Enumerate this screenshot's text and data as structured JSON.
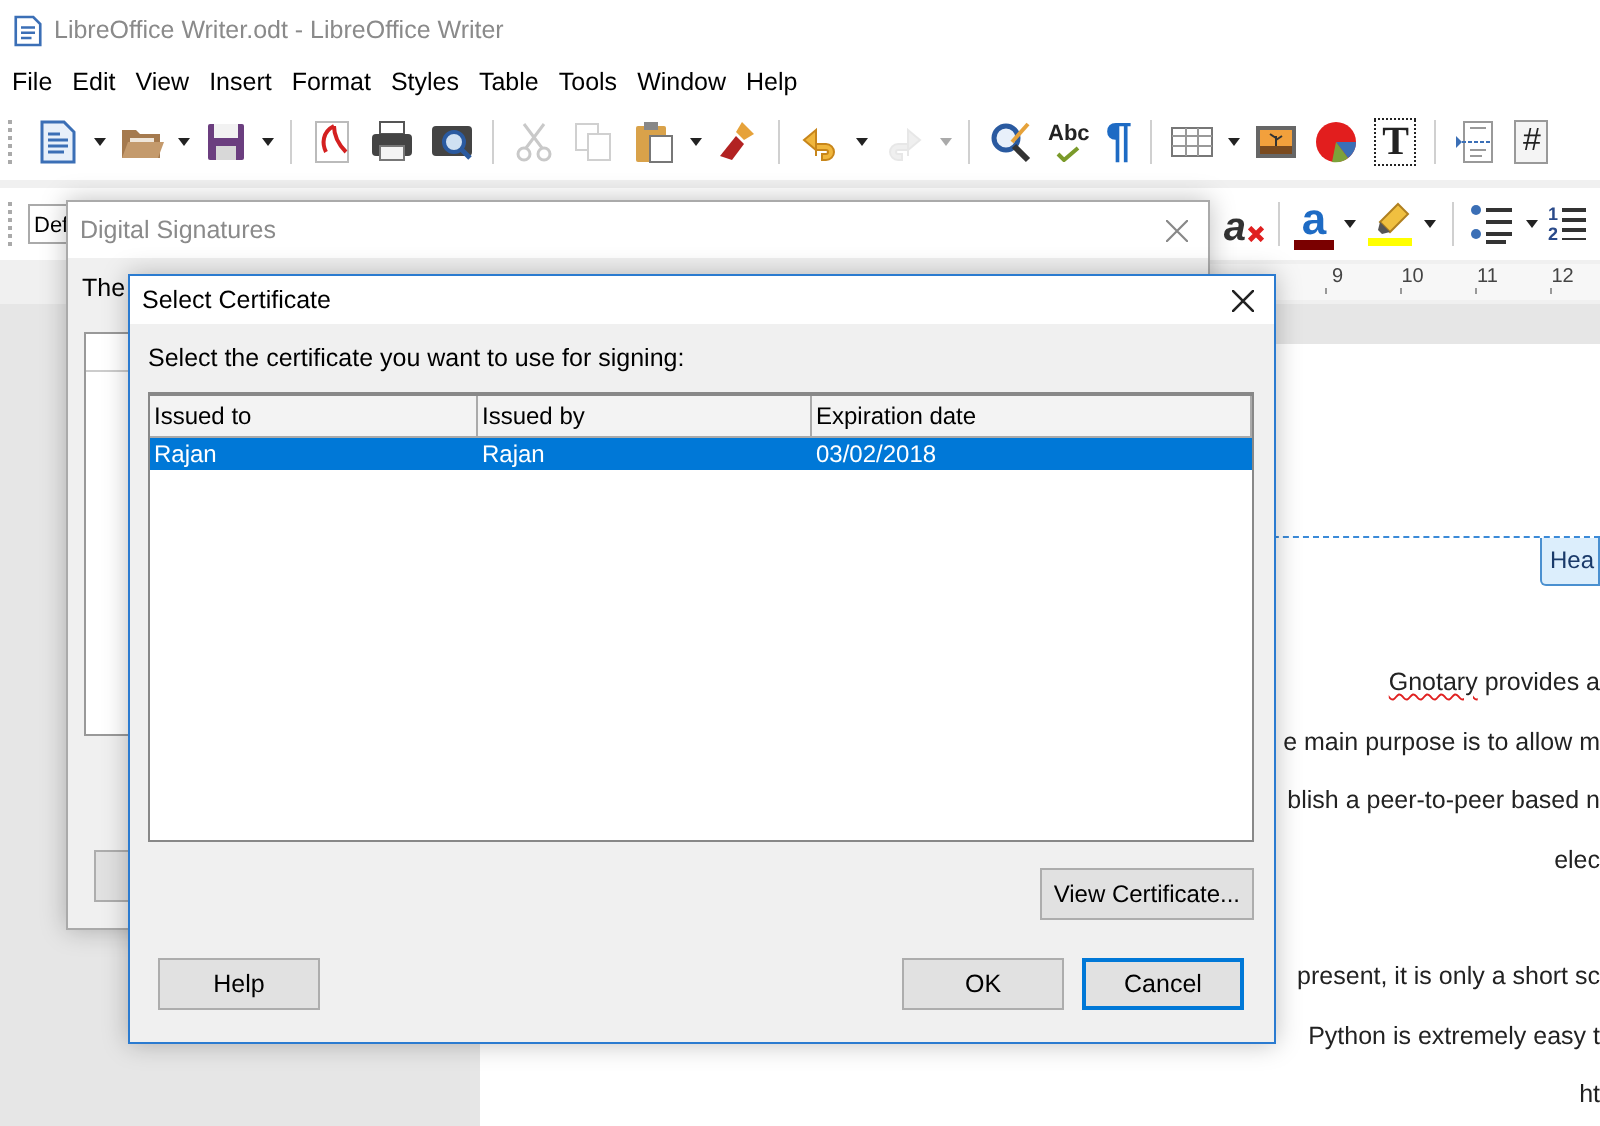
{
  "window": {
    "title": "LibreOffice Writer.odt - LibreOffice Writer",
    "active": false
  },
  "menu": [
    "File",
    "Edit",
    "View",
    "Insert",
    "Format",
    "Styles",
    "Table",
    "Tools",
    "Window",
    "Help"
  ],
  "toolbar": [
    {
      "kind": "new",
      "dropdown": true,
      "disabled": false
    },
    {
      "kind": "open",
      "dropdown": true,
      "disabled": false
    },
    {
      "kind": "save",
      "dropdown": true,
      "disabled": false
    },
    {
      "kind": "separator"
    },
    {
      "kind": "pdf",
      "disabled": false
    },
    {
      "kind": "print",
      "disabled": false
    },
    {
      "kind": "preview",
      "disabled": false
    },
    {
      "kind": "separator"
    },
    {
      "kind": "cut",
      "disabled": true
    },
    {
      "kind": "copy",
      "disabled": true
    },
    {
      "kind": "paste",
      "dropdown": true,
      "disabled": false
    },
    {
      "kind": "clone",
      "disabled": false
    },
    {
      "kind": "separator"
    },
    {
      "kind": "undo",
      "dropdown": true,
      "disabled": false
    },
    {
      "kind": "redo",
      "dropdown": true,
      "disabled": true
    },
    {
      "kind": "separator"
    },
    {
      "kind": "find",
      "disabled": false
    },
    {
      "kind": "spelling",
      "glyph": "Abc",
      "disabled": false
    },
    {
      "kind": "marks",
      "glyph": "¶",
      "disabled": false
    },
    {
      "kind": "separator"
    },
    {
      "kind": "table",
      "dropdown": true,
      "disabled": false
    },
    {
      "kind": "image",
      "disabled": false
    },
    {
      "kind": "chart",
      "disabled": false
    },
    {
      "kind": "textbox",
      "glyph": "T",
      "disabled": false
    },
    {
      "kind": "separator"
    },
    {
      "kind": "field",
      "disabled": false
    },
    {
      "kind": "glyph",
      "glyph": "#",
      "disabled": false
    }
  ],
  "formatting": {
    "style": "Def",
    "items": [
      {
        "kind": "clear",
        "glyph": "a"
      },
      {
        "kind": "separator"
      },
      {
        "kind": "font-color",
        "glyph": "a",
        "dropdown": true
      },
      {
        "kind": "highlight",
        "dropdown": true
      },
      {
        "kind": "separator"
      },
      {
        "kind": "bullets",
        "dropdown": true
      },
      {
        "kind": "numbering",
        "glyph": [
          "1",
          "2"
        ]
      }
    ]
  },
  "ruler": [
    "9",
    "10",
    "11",
    "12"
  ],
  "document": {
    "header_tab": "Hea",
    "paragraphs": [
      [
        {
          "segments": [
            {
              "text": "Gnotary",
              "misspelled": true
            },
            {
              "text": " provides a",
              "misspelled": false
            }
          ]
        },
        {
          "segments": [
            {
              "text": "e main purpose is to allow m",
              "misspelled": false
            }
          ]
        },
        {
          "segments": [
            {
              "text": "blish a peer-to-peer based n",
              "misspelled": false
            }
          ]
        },
        {
          "segments": [
            {
              "text": "elec",
              "misspelled": false
            }
          ]
        }
      ],
      [
        {
          "segments": [
            {
              "text": "present, it is only a short sc",
              "misspelled": false
            }
          ]
        },
        {
          "segments": [
            {
              "text": "Python is extremely easy t",
              "misspelled": false
            }
          ]
        },
        {
          "segments": [
            {
              "text": "ht",
              "misspelled": false
            }
          ]
        }
      ]
    ]
  },
  "digital_signatures": {
    "title": "Digital Signatures",
    "active": false,
    "text": "The"
  },
  "select_certificate": {
    "title": "Select Certificate",
    "active": true,
    "prompt": "Select the certificate you want to use for signing:",
    "columns": [
      "Issued to",
      "Issued by",
      "Expiration date"
    ],
    "rows": [
      {
        "cells": [
          "Rajan",
          "Rajan",
          "03/02/2018"
        ],
        "selected": true
      }
    ],
    "view_button": "View Certificate...",
    "buttons": [
      {
        "label": "Help",
        "kind": "help",
        "default": false
      },
      {
        "label": "OK",
        "kind": "ok",
        "default": false
      },
      {
        "label": "Cancel",
        "kind": "cancel",
        "default": true
      }
    ]
  }
}
